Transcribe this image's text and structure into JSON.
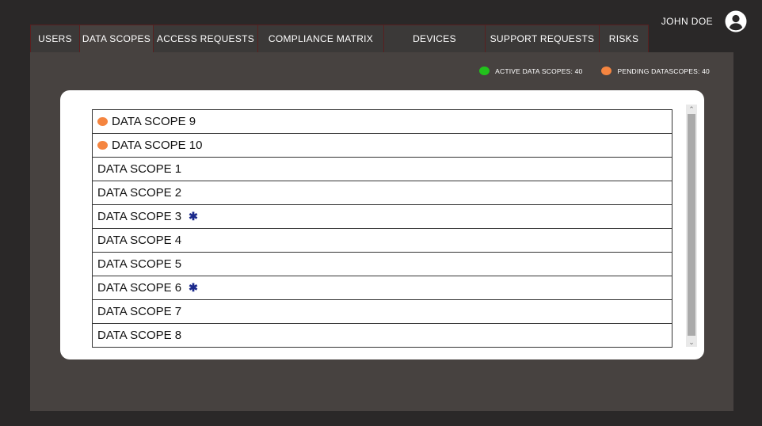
{
  "user": {
    "name": "JOHN DOE",
    "avatar_icon": "account-circle-icon"
  },
  "tabs": [
    {
      "label": "USERS"
    },
    {
      "label": "DATA SCOPES"
    },
    {
      "label": "ACCESS REQUESTS"
    },
    {
      "label": "COMPLIANCE MATRIX"
    },
    {
      "label": "DEVICES"
    },
    {
      "label": "SUPPORT REQUESTS"
    },
    {
      "label": "RISKS"
    }
  ],
  "active_tab": "DATA SCOPES",
  "legend": {
    "active": {
      "label": "ACTIVE DATA SCOPES: 40",
      "color": "#22c21c"
    },
    "pending": {
      "label": "PENDING DATASCOPES: 40",
      "color": "#f58540"
    }
  },
  "rows": [
    {
      "label": "DATA SCOPE 9",
      "pending": true,
      "starred": false
    },
    {
      "label": "DATA SCOPE 10",
      "pending": true,
      "starred": false
    },
    {
      "label": "DATA SCOPE 1",
      "pending": false,
      "starred": false
    },
    {
      "label": "DATA SCOPE 2",
      "pending": false,
      "starred": false
    },
    {
      "label": "DATA SCOPE 3",
      "pending": false,
      "starred": true
    },
    {
      "label": "DATA SCOPE 4",
      "pending": false,
      "starred": false
    },
    {
      "label": "DATA SCOPE 5",
      "pending": false,
      "starred": false
    },
    {
      "label": "DATA SCOPE 6",
      "pending": false,
      "starred": true
    },
    {
      "label": "DATA SCOPE 7",
      "pending": false,
      "starred": false
    },
    {
      "label": "DATA SCOPE 8",
      "pending": false,
      "starred": false
    }
  ],
  "star_glyph": "✱",
  "colors": {
    "pending": "#f58540",
    "star": "#1b2a8c"
  }
}
